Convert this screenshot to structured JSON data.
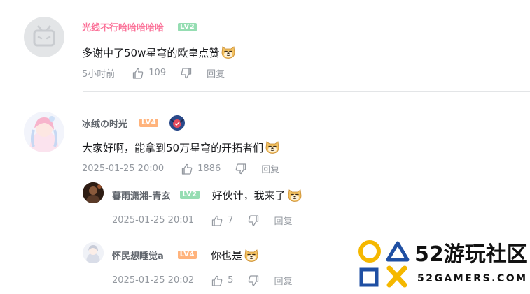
{
  "comments": [
    {
      "user": "光线不行哈哈哈哈哈",
      "level": "LV2",
      "content": "多谢中了50w星穹的欧皇点赞",
      "time": "5小时前",
      "likes": "109",
      "reply_label": "回复"
    },
    {
      "user": "冰绒の时光",
      "level": "LV4",
      "content": "大家好啊，能拿到50万星穹的开拓者们",
      "time": "2025-01-25 20:00",
      "likes": "1886",
      "reply_label": "回复",
      "replies": [
        {
          "user": "暮雨潇湘-青玄",
          "level": "LV2",
          "content": "好伙计，我来了",
          "time": "2025-01-25 20:01",
          "likes": "7",
          "reply_label": "回复"
        },
        {
          "user": "怀民想睡觉a",
          "level": "LV4",
          "content": "你也是",
          "time": "2025-01-25 20:02",
          "likes": "5",
          "reply_label": "回复"
        }
      ]
    }
  ],
  "watermark": {
    "title": "52游玩社区",
    "subtitle": "52GAMERS.COM"
  },
  "colors": {
    "username_pink": "#fb7299",
    "level_green": "#95ddb2",
    "level_orange": "#ffb37c",
    "meta_gray": "#9499a0",
    "watermark_yellow": "#f5b800",
    "watermark_blue": "#1f4fa3"
  }
}
